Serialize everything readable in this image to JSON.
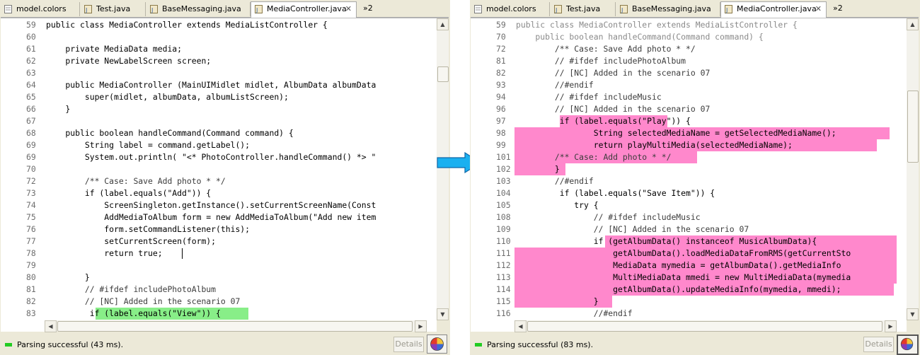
{
  "colors": {
    "highlight_green": "#88ee88",
    "highlight_pink": "#ff88cc",
    "comment": "#3c3c3c",
    "greyed": "#8a8a8a",
    "keyword": "#000000"
  },
  "left": {
    "tabs": [
      "model.colors",
      "Test.java",
      "BaseMessaging.java",
      "MediaController.java"
    ],
    "overflow_label": "»2",
    "status_text": "Parsing successful (43 ms).",
    "details_label": "Details",
    "lines": [
      {
        "n": "59",
        "t": "public class MediaController extends MediaListController {"
      },
      {
        "n": "60",
        "t": ""
      },
      {
        "n": "61",
        "t": "    private MediaData media;"
      },
      {
        "n": "62",
        "t": "    private NewLabelScreen screen;"
      },
      {
        "n": "63",
        "t": ""
      },
      {
        "n": "64",
        "t": "    public MediaController (MainUIMidlet midlet, AlbumData albumData"
      },
      {
        "n": "65",
        "t": "        super(midlet, albumData, albumListScreen);"
      },
      {
        "n": "66",
        "t": "    }"
      },
      {
        "n": "67",
        "t": ""
      },
      {
        "n": "68",
        "t": "    public boolean handleCommand(Command command) {"
      },
      {
        "n": "69",
        "t": "        String label = command.getLabel();"
      },
      {
        "n": "69",
        "t": "        System.out.println( \"<* PhotoController.handleCommand() *> \""
      },
      {
        "n": "70",
        "t": ""
      },
      {
        "n": "72",
        "t": "        /** Case: Save Add photo * */"
      },
      {
        "n": "73",
        "t": "        if (label.equals(\"Add\")) {"
      },
      {
        "n": "74",
        "t": "            ScreenSingleton.getInstance().setCurrentScreenName(Const"
      },
      {
        "n": "75",
        "t": "            AddMediaToAlbum form = new AddMediaToAlbum(\"Add new item"
      },
      {
        "n": "76",
        "t": "            form.setCommandListener(this);"
      },
      {
        "n": "77",
        "t": "            setCurrentScreen(form);"
      },
      {
        "n": "78",
        "t": "            return true;"
      },
      {
        "n": "79",
        "t": ""
      },
      {
        "n": "80",
        "t": "        }"
      },
      {
        "n": "81",
        "t": "        // #ifdef includePhotoAlbum"
      },
      {
        "n": "82",
        "t": "        // [NC] Added in the scenario 07"
      },
      {
        "n": "83",
        "t": "         if (label.equals(\"View\")) {"
      }
    ]
  },
  "right": {
    "tabs": [
      "model.colors",
      "Test.java",
      "BaseMessaging.java",
      "MediaController.java"
    ],
    "overflow_label": "»2",
    "status_text": "Parsing successful (83 ms).",
    "details_label": "Details",
    "lines": [
      {
        "n": "59",
        "t": "public class MediaController extends MediaListController {"
      },
      {
        "n": "70",
        "t": "    public boolean handleCommand(Command command) {"
      },
      {
        "n": "72",
        "t": "        /** Case: Save Add photo * */"
      },
      {
        "n": "81",
        "t": "        // #ifdef includePhotoAlbum"
      },
      {
        "n": "82",
        "t": "        // [NC] Added in the scenario 07"
      },
      {
        "n": "93",
        "t": "        //#endif"
      },
      {
        "n": "94",
        "t": "        // #ifdef includeMusic"
      },
      {
        "n": "96",
        "t": "        // [NC] Added in the scenario 07"
      },
      {
        "n": "97",
        "t": "         if (label.equals(\"Play\")) {"
      },
      {
        "n": "98",
        "t": "                String selectedMediaName = getSelectedMediaName();"
      },
      {
        "n": "99",
        "t": "                return playMultiMedia(selectedMediaName);"
      },
      {
        "n": "101",
        "t": "        /** Case: Add photo * */"
      },
      {
        "n": "102",
        "t": "        }"
      },
      {
        "n": "103",
        "t": "        //#endif"
      },
      {
        "n": "104",
        "t": "         if (label.equals(\"Save Item\")) {"
      },
      {
        "n": "105",
        "t": "            try {"
      },
      {
        "n": "108",
        "t": "                // #ifdef includeMusic"
      },
      {
        "n": "109",
        "t": "                // [NC] Added in the scenario 07"
      },
      {
        "n": "110",
        "t": "                if (getAlbumData() instanceof MusicAlbumData){"
      },
      {
        "n": "111",
        "t": "                    getAlbumData().loadMediaDataFromRMS(getCurrentSto"
      },
      {
        "n": "112",
        "t": "                    MediaData mymedia = getAlbumData().getMediaInfo"
      },
      {
        "n": "113",
        "t": "                    MultiMediaData mmedi = new MultiMediaData(mymedia"
      },
      {
        "n": "114",
        "t": "                    getAlbumData().updateMediaInfo(mymedia, mmedi);"
      },
      {
        "n": "115",
        "t": "                }"
      },
      {
        "n": "116",
        "t": "                //#endif"
      }
    ]
  }
}
